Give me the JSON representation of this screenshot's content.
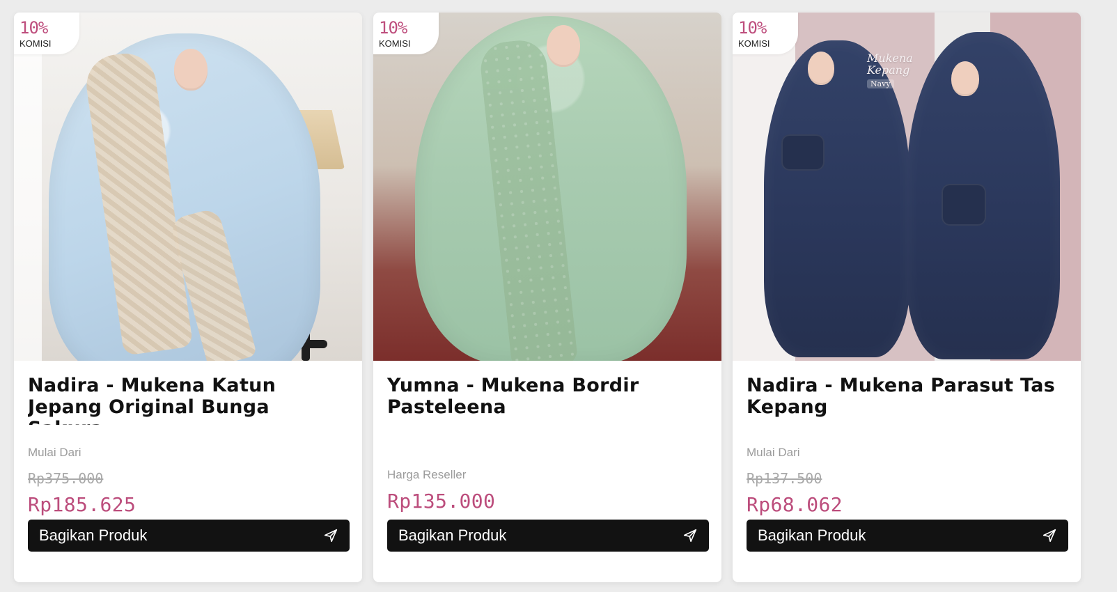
{
  "products": [
    {
      "commission": {
        "percent": "10%",
        "label": "KOMISI"
      },
      "title": "Nadira - Mukena Katun Jepang Original Bunga Sakura",
      "meta_label": "Mulai Dari",
      "original_price": "Rp375.000",
      "sale_price": "Rp185.625",
      "button_label": "Bagikan Produk",
      "icon": "send-icon"
    },
    {
      "commission": {
        "percent": "10%",
        "label": "KOMISI"
      },
      "title": "Yumna - Mukena Bordir Pasteleena",
      "meta_label": "Harga Reseller",
      "sale_price": "Rp135.000",
      "button_label": "Bagikan Produk",
      "icon": "send-icon"
    },
    {
      "commission": {
        "percent": "10%",
        "label": "KOMISI"
      },
      "image_text": {
        "line1": "Mukena",
        "line2": "Kepang",
        "tag": "Navy"
      },
      "title": "Nadira - Mukena Parasut Tas Kepang",
      "meta_label": "Mulai Dari",
      "original_price": "Rp137.500",
      "sale_price": "Rp68.062",
      "button_label": "Bagikan Produk",
      "icon": "send-icon"
    }
  ],
  "colors": {
    "accent": "#bc4d7c",
    "button_bg": "#121212",
    "page_bg": "#ececec"
  }
}
